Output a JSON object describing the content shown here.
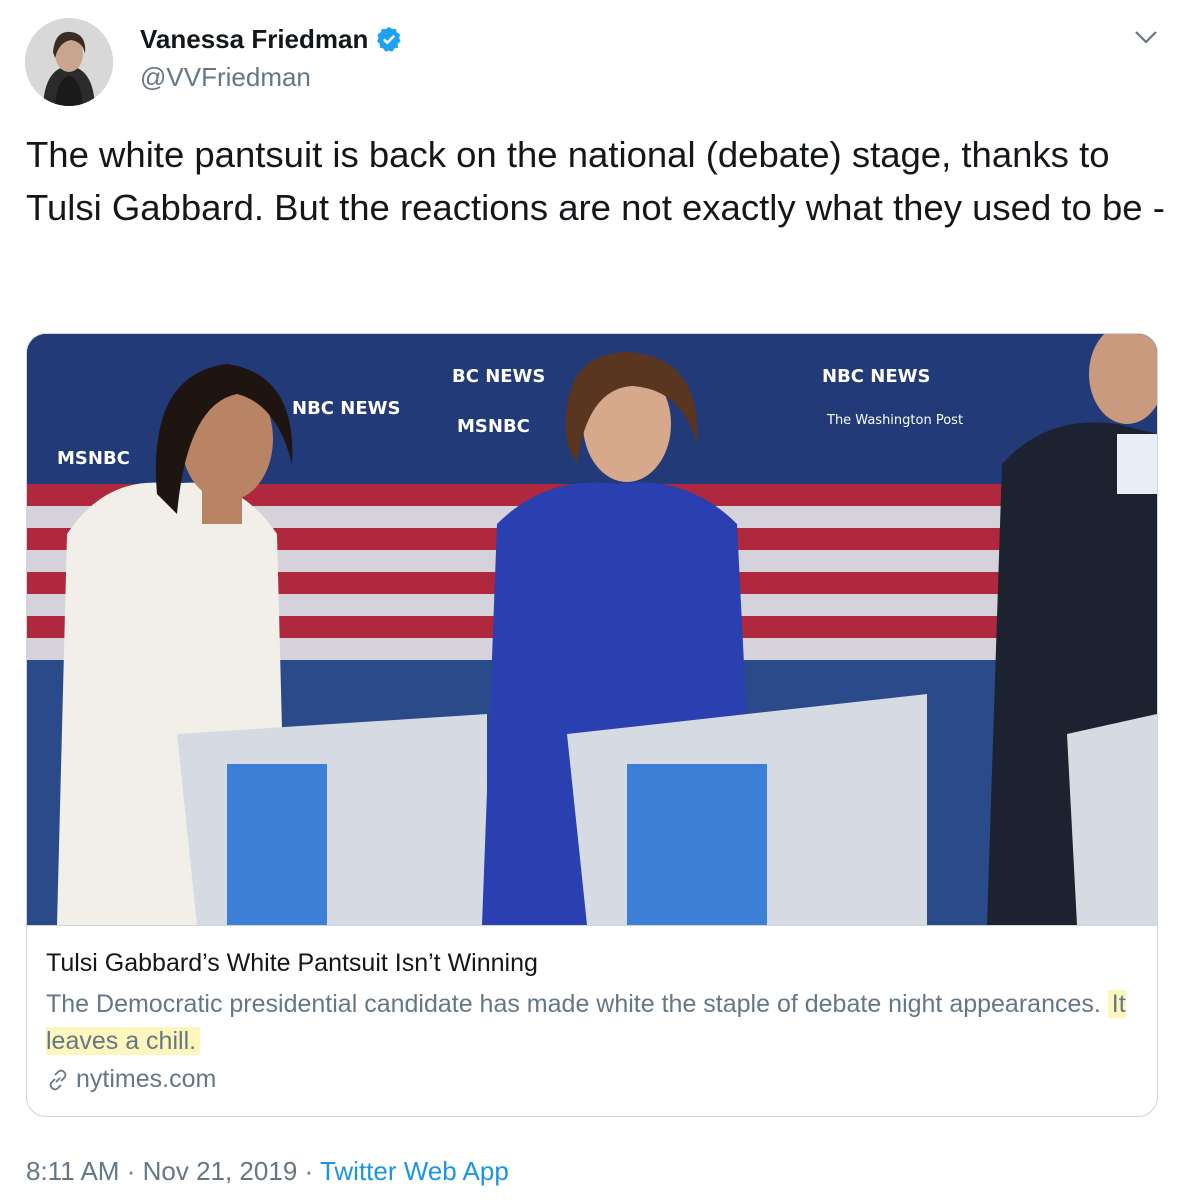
{
  "user": {
    "name": "Vanessa Friedman",
    "handle": "@VVFriedman"
  },
  "tweet": {
    "text": "The white pantsuit is back on the national (debate) stage, thanks to Tulsi Gabbard. But the reactions are not exactly what they used to be -"
  },
  "card": {
    "title": "Tulsi Gabbard’s White Pantsuit Isn’t Winning",
    "description": "The Democratic presidential candidate has made white the staple of debate night appearances.",
    "description_highlight": "It leaves a chill.",
    "domain": "nytimes.com",
    "image_banner_texts": [
      "BC NEWS",
      "MSNBC",
      "NBC NEWS",
      "MSNBC",
      "NBC NEWS",
      "The Washington Post"
    ]
  },
  "meta": {
    "time": "8:11 AM",
    "separator": "·",
    "date": "Nov 21, 2019",
    "app": "Twitter Web App"
  },
  "colors": {
    "text_primary": "#14171a",
    "text_secondary": "#657786",
    "link_blue": "#1b95e0",
    "verified_blue": "#1da1f2",
    "highlight": "#fdf7bd"
  }
}
